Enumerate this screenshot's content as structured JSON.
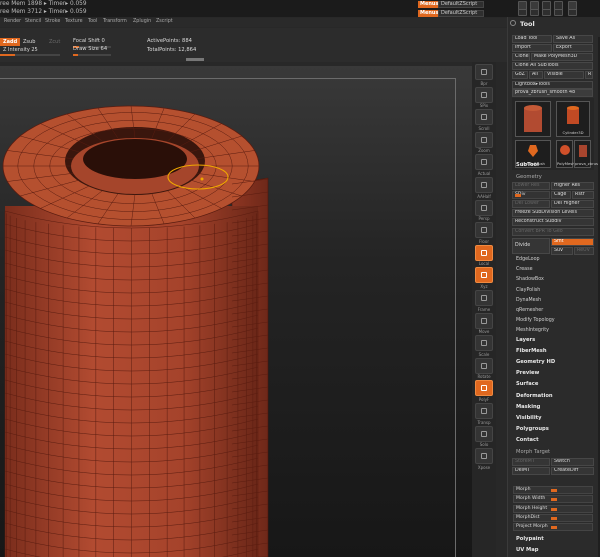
{
  "titlebar": {
    "line1": "ree Mem 1898 ▸ Timer▸ 0.059",
    "line2": "ree Mem 3712 ▸ Timer▸ 0.059",
    "menus_btn_1": "Menus",
    "script_btn_1": "DefaultZScript",
    "menus_btn_2": "Menus",
    "script_btn_2": "DefaultZScript"
  },
  "menubar": {
    "items": [
      "Render",
      "Stencil",
      "Stroke",
      "Texture",
      "Tool",
      "Transform",
      "Zplugin",
      "Zscript"
    ]
  },
  "brushbar": {
    "zadd": "Zadd",
    "zsub": "Zsub",
    "zcut": "Zcut",
    "rgb_label": "Rgb",
    "z_intensity_label": "Z Intensity",
    "z_intensity_value": "25",
    "z_intensity_level": 0.25,
    "focal_shift_label": "Focal Shift",
    "focal_shift_value": "0",
    "focal_shift_level": 0.5,
    "draw_size_label": "Draw Size",
    "draw_size_value": "64",
    "draw_size_level": 0.12,
    "active_points": "ActivePoints: 884",
    "total_points": "TotalPoints: 12,864"
  },
  "shelf": {
    "items": [
      "Bpr",
      "SPix",
      "Scroll",
      "Zoom",
      "Actual",
      "AAHalf",
      "Persp",
      "Floor",
      "Local",
      "Xyz",
      "Frame",
      "Move",
      "Scale",
      "Rotate",
      "PolyF",
      "Transp",
      "Solo",
      "Xpose"
    ],
    "active": [
      "Local",
      "Xyz",
      "PolyF"
    ]
  },
  "tool_panel": {
    "title": "Tool",
    "buttons": {
      "load_tool": "Load Tool",
      "save_as": "Save As",
      "import": "Import",
      "export": "Export",
      "clone": "Clone",
      "make_polymesh": "Make PolyMesh3D",
      "clone_all": "Clone All SubTools",
      "goz": "GoZ",
      "all": "All",
      "visible": "Visible",
      "r": "R"
    },
    "lightbox_tools": "Lightbox▸Tools",
    "current_tool": "prova_zbrush_smooth 48",
    "thumbs": [
      "",
      "Cylinder3D",
      "SimpleBrush",
      "PolyMesh3D",
      "prova_zbrush_sm"
    ],
    "subtool": "SubTool",
    "geometry": "Geometry",
    "higher_res": "Higher Res",
    "lower_res": "Lower Res",
    "cage": "Cage",
    "rstr": "Rstr",
    "sdiv": "SDiv",
    "del_lower": "Del Lower",
    "del_higher": "Del Higher",
    "freeze_subdiv": "Freeze SubDivision Levels",
    "reconstruct_subdiv": "Reconstruct Subdiv",
    "convert_bpr": "Convert BPR To Geo",
    "divide": "Divide",
    "smt": "Smt",
    "suv": "Suv",
    "reuv": "ReUV",
    "geometry_items": [
      "EdgeLoop",
      "Crease",
      "ShadowBox",
      "ClayPolish",
      "DynaMesh",
      "qRemesher",
      "Modify Topology",
      "MeshIntegrity"
    ],
    "sections": [
      "Layers",
      "FiberMesh",
      "Geometry HD",
      "Preview",
      "Surface",
      "Deformation",
      "Masking",
      "Visibility",
      "Polygroups",
      "Contact"
    ],
    "morph_target": "Morph Target",
    "storemt": "StoreMT",
    "switch": "Switch",
    "delmt": "DelMT",
    "creatediff": "CreateDiff",
    "sliders": [
      {
        "label": "Morph",
        "level": 0.5
      },
      {
        "label": "Morph Width",
        "level": 0.5
      },
      {
        "label": "Morph Height",
        "level": 0.5
      },
      {
        "label": "MorphDist",
        "level": 0.5
      },
      {
        "label": "Project Morph",
        "level": 0.5
      }
    ],
    "polypaint": "Polypaint",
    "uv_map": "UV Map"
  },
  "colors": {
    "accent": "#e0681f",
    "mesh_fill": "#a8452e",
    "wire": "#5a1c10"
  }
}
